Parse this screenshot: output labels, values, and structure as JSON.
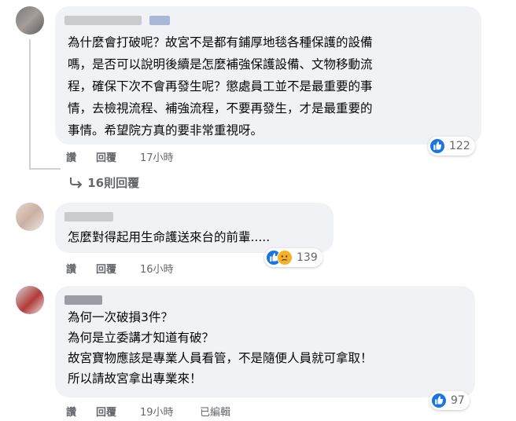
{
  "comments": [
    {
      "text_lines": [
        "為什麼會打破呢？故宮不是都有鋪厚地毯各種保護的設備",
        "嗎，是否可以說明後續是怎麼補強保護設備、文物移動流",
        "程，確保下次不會再發生呢？懲處員工並不是最重要的事",
        "情，去檢視流程、補強流程，不要再發生，才是最重要的",
        "事情。希望院方真的要非常重視呀。"
      ],
      "like_label": "讚",
      "reply_label": "回覆",
      "time": "17小時",
      "reaction_count": "122",
      "view_replies": "16則回覆"
    },
    {
      "text_lines": [
        "怎麼對得起用生命護送來台的前輩....."
      ],
      "like_label": "讚",
      "reply_label": "回覆",
      "time": "16小時",
      "reaction_count": "139"
    },
    {
      "text_lines": [
        "為何一次破損3件？",
        "為何是立委講才知道有破？",
        "故宮寶物應該是專業人員看管，不是隨便人員就可拿取！",
        "所以請故宮拿出專業來！"
      ],
      "like_label": "讚",
      "reply_label": "回覆",
      "time": "19小時",
      "edited": "已編輯",
      "reaction_count": "97"
    }
  ],
  "colors": {
    "bubble": "#f0f2f5",
    "like_blue": "#1b74e4",
    "sad_yellow": "#f7b125",
    "secondary_text": "#65676b"
  }
}
